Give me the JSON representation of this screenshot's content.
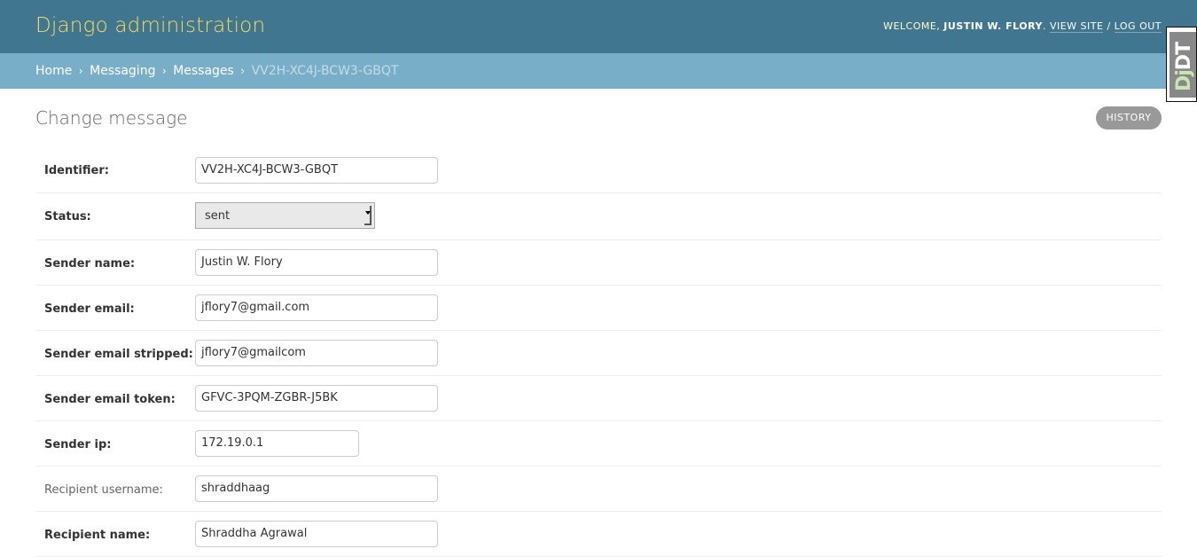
{
  "header": {
    "site_name": "Django administration",
    "welcome": "Welcome,",
    "user_name": "Justin W. Flory",
    "view_site": "View site",
    "separator": "/",
    "log_out": "Log out"
  },
  "breadcrumbs": {
    "home": "Home",
    "app": "Messaging",
    "model": "Messages",
    "current": "VV2H-XC4J-BCW3-GBQT",
    "separator": "›"
  },
  "debug_toolbar": {
    "label_dj": "Dj",
    "label_dt": "DT"
  },
  "content": {
    "title": "Change message",
    "history_button": "History"
  },
  "form": {
    "identifier": {
      "label": "Identifier:",
      "value": "VV2H-XC4J-BCW3-GBQT"
    },
    "status": {
      "label": "Status:",
      "value": "sent"
    },
    "sender_name": {
      "label": "Sender name:",
      "value": "Justin W. Flory"
    },
    "sender_email": {
      "label": "Sender email:",
      "value": "jflory7@gmail.com"
    },
    "sender_email_stripped": {
      "label": "Sender email stripped:",
      "value": "jflory7@gmailcom"
    },
    "sender_email_token": {
      "label": "Sender email token:",
      "value": "GFVC-3PQM-ZGBR-J5BK"
    },
    "sender_ip": {
      "label": "Sender ip:",
      "value": "172.19.0.1"
    },
    "recipient_username": {
      "label": "Recipient username:",
      "value": "shraddhaag"
    },
    "recipient_name": {
      "label": "Recipient name:",
      "value": "Shraddha Agrawal"
    }
  }
}
